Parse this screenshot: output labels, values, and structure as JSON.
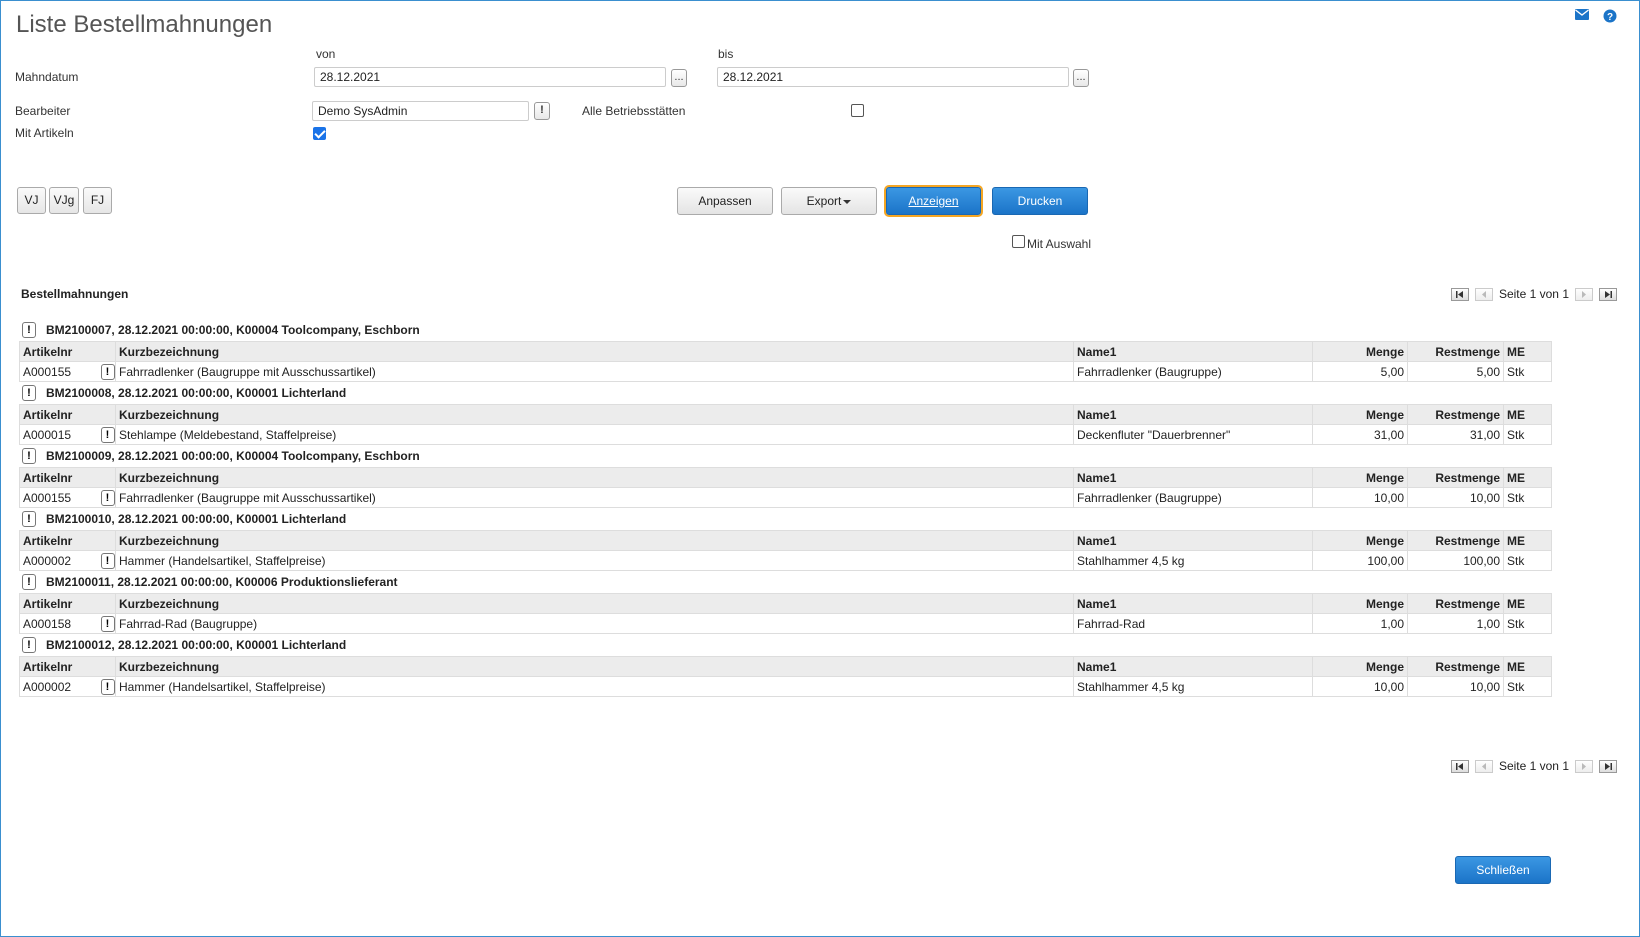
{
  "header": {
    "title": "Liste Bestellmahnungen",
    "mail_icon": "mail-icon",
    "help_icon": "help-icon"
  },
  "filters": {
    "von_label": "von",
    "bis_label": "bis",
    "mahndatum_label": "Mahndatum",
    "mahndatum_von": "28.12.2021",
    "mahndatum_bis": "28.12.2021",
    "picker_label": "...",
    "bearbeiter_label": "Bearbeiter",
    "bearbeiter_value": "Demo SysAdmin",
    "alle_betriebsstaetten_label": "Alle Betriebsstätten",
    "alle_betriebsstaetten_checked": false,
    "mit_artikeln_label": "Mit Artikeln",
    "mit_artikeln_checked": true,
    "excl_symbol": "!"
  },
  "quick_buttons": [
    "VJ",
    "VJg",
    "FJ"
  ],
  "actions": {
    "anpassen": "Anpassen",
    "export": "Export",
    "anzeigen": "Anzeigen",
    "drucken": "Drucken",
    "mit_auswahl_label": "Mit Auswahl",
    "mit_auswahl_checked": false
  },
  "list": {
    "title": "Bestellmahnungen",
    "pager_text": "Seite 1 von 1",
    "columns": [
      "Artikelnr",
      "Kurzbezeichnung",
      "Name1",
      "Menge",
      "Restmenge",
      "ME"
    ],
    "groups": [
      {
        "header": "BM2100007, 28.12.2021 00:00:00, K00004 Toolcompany, Eschborn",
        "rows": [
          [
            "A000155",
            "Fahrradlenker (Baugruppe mit Ausschussartikel)",
            "Fahrradlenker (Baugruppe)",
            "5,00",
            "5,00",
            "Stk"
          ]
        ]
      },
      {
        "header": "BM2100008, 28.12.2021 00:00:00, K00001 Lichterland",
        "rows": [
          [
            "A000015",
            "Stehlampe (Meldebestand, Staffelpreise)",
            "Deckenfluter \"Dauerbrenner\"",
            "31,00",
            "31,00",
            "Stk"
          ]
        ]
      },
      {
        "header": "BM2100009, 28.12.2021 00:00:00, K00004 Toolcompany, Eschborn",
        "rows": [
          [
            "A000155",
            "Fahrradlenker (Baugruppe mit Ausschussartikel)",
            "Fahrradlenker (Baugruppe)",
            "10,00",
            "10,00",
            "Stk"
          ]
        ]
      },
      {
        "header": "BM2100010, 28.12.2021 00:00:00, K00001 Lichterland",
        "rows": [
          [
            "A000002",
            "Hammer (Handelsartikel, Staffelpreise)",
            "Stahlhammer 4,5 kg",
            "100,00",
            "100,00",
            "Stk"
          ]
        ]
      },
      {
        "header": "BM2100011, 28.12.2021 00:00:00, K00006 Produktionslieferant",
        "rows": [
          [
            "A000158",
            "Fahrrad-Rad (Baugruppe)",
            "Fahrrad-Rad",
            "1,00",
            "1,00",
            "Stk"
          ]
        ]
      },
      {
        "header": "BM2100012, 28.12.2021 00:00:00, K00001 Lichterland",
        "rows": [
          [
            "A000002",
            "Hammer (Handelsartikel, Staffelpreise)",
            "Stahlhammer 4,5 kg",
            "10,00",
            "10,00",
            "Stk"
          ]
        ]
      }
    ]
  },
  "footer": {
    "schliessen": "Schließen"
  }
}
